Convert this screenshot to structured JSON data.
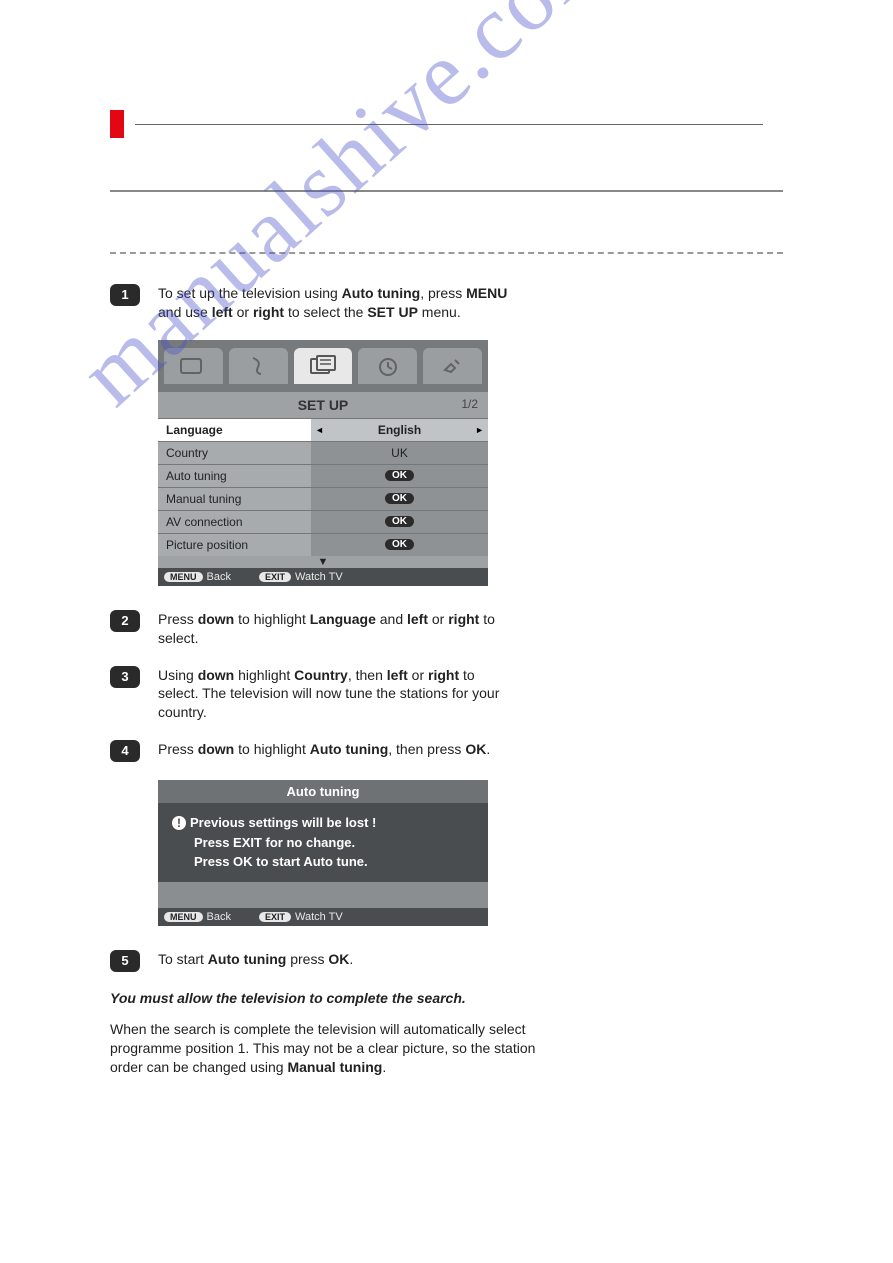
{
  "watermark": "manualshive.com",
  "steps": {
    "s1": {
      "num": "1",
      "html": "To set up the television using <b>Auto tuning</b>, press <b>MENU</b> and use <b>left</b> or <b>right</b> to select the <b>SET UP</b> menu."
    },
    "s2": {
      "num": "2",
      "html": "Press <b>down</b> to highlight <b>Language</b> and <b>left</b> or <b>right</b> to select."
    },
    "s3": {
      "num": "3",
      "html": "Using <b>down</b> highlight <b>Country</b>, then <b>left</b> or <b>right</b> to select. The television will now tune the stations for your country."
    },
    "s4": {
      "num": "4",
      "html": "Press <b>down</b> to highlight <b>Auto tuning</b>, then press <b>OK</b>."
    },
    "s5": {
      "num": "5",
      "html": "To start <b>Auto tuning</b> press <b>OK</b>."
    }
  },
  "osd1": {
    "title": "SET UP",
    "page": "1/2",
    "rows": [
      {
        "label": "Language",
        "value": "English",
        "type": "select",
        "selected": true
      },
      {
        "label": "Country",
        "value": "UK",
        "type": "text"
      },
      {
        "label": "Auto tuning",
        "value": "OK",
        "type": "ok"
      },
      {
        "label": "Manual tuning",
        "value": "OK",
        "type": "ok"
      },
      {
        "label": "AV connection",
        "value": "OK",
        "type": "ok"
      },
      {
        "label": "Picture position",
        "value": "OK",
        "type": "ok"
      }
    ],
    "footer": {
      "menu_pill": "MENU",
      "back": "Back",
      "exit_pill": "EXIT",
      "watch": "Watch TV"
    }
  },
  "osd2": {
    "title": "Auto tuning",
    "line1": "Previous settings will be lost  !",
    "line2": "Press EXIT for no change.",
    "line3": "Press OK to start Auto tune.",
    "footer": {
      "menu_pill": "MENU",
      "back": "Back",
      "exit_pill": "EXIT",
      "watch": "Watch TV"
    }
  },
  "bold_italic": "You must allow the television to complete the search.",
  "final_para_html": "When the search is complete the television will automatically select programme position 1. This may not be a clear picture, so the station order can be changed using <b>Manual tuning</b>."
}
